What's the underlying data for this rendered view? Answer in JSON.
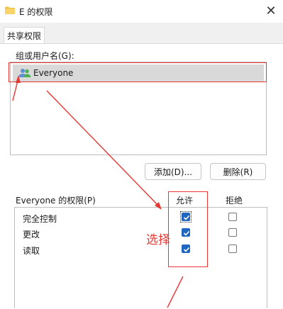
{
  "window": {
    "title": "E 的权限",
    "close_glyph": "✕"
  },
  "tabs": [
    {
      "label": "共享权限"
    }
  ],
  "groups": {
    "label": "组或用户名(G):",
    "items": [
      {
        "name": "Everyone",
        "icon": "users-icon",
        "selected": true
      }
    ]
  },
  "buttons": {
    "add": "添加(D)...",
    "remove": "删除(R)"
  },
  "permissions": {
    "label": "Everyone 的权限(P)",
    "allow_header": "允许",
    "deny_header": "拒绝",
    "rows": [
      {
        "name": "完全控制",
        "allow": true,
        "deny": false
      },
      {
        "name": "更改",
        "allow": true,
        "deny": false
      },
      {
        "name": "读取",
        "allow": true,
        "deny": false
      }
    ]
  },
  "annotation": {
    "text": "选择",
    "color": "#e53935"
  },
  "colors": {
    "accent": "#1f66c1",
    "annotation_red": "#e53935",
    "selection": "#d9d9d9"
  }
}
